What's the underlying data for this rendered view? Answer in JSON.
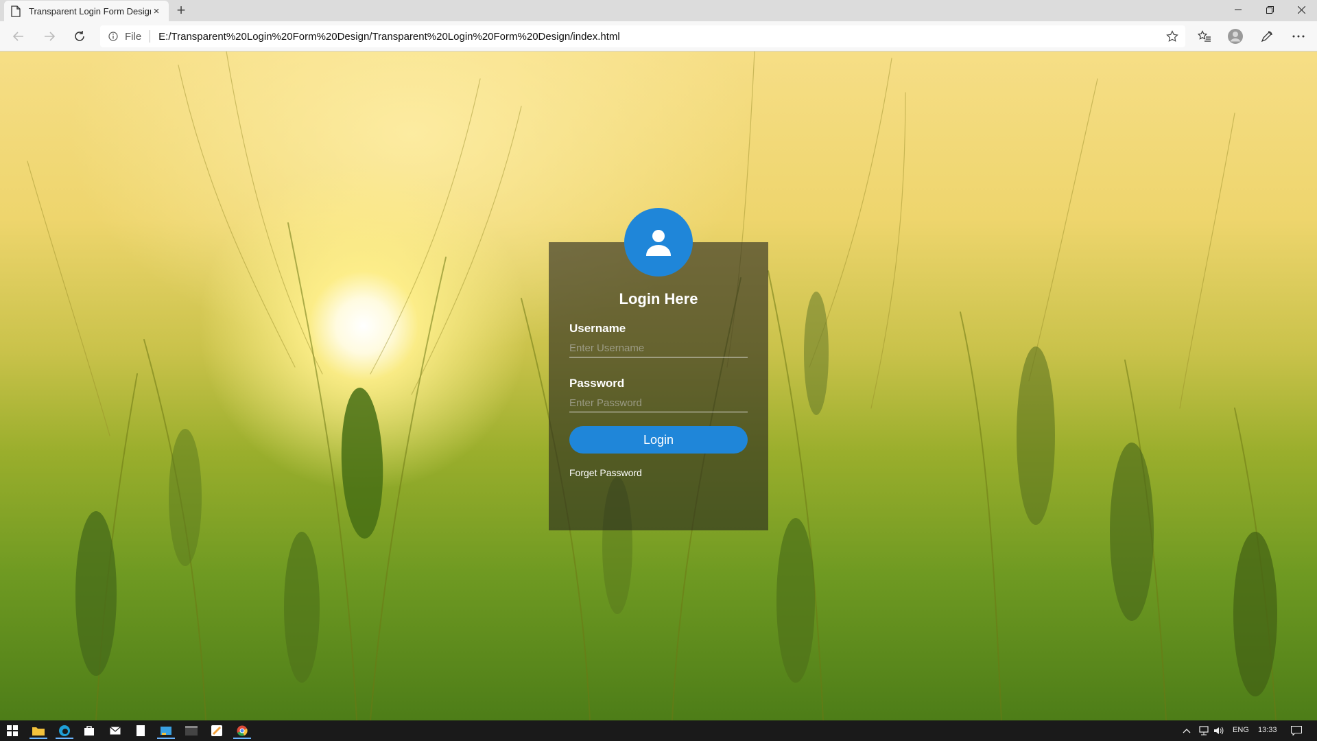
{
  "browser": {
    "tab_title": "Transparent Login Form Design",
    "tab_close": "×",
    "new_tab": "+",
    "address_prefix": "File",
    "url": "E:/Transparent%20Login%20Form%20Design/Transparent%20Login%20Form%20Design/index.html"
  },
  "login": {
    "title": "Login Here",
    "username_label": "Username",
    "username_placeholder": "Enter Username",
    "password_label": "Password",
    "password_placeholder": "Enter Password",
    "button_label": "Login",
    "forget_link": "Forget Password"
  },
  "taskbar": {
    "language": "ENG",
    "time": "13:33"
  },
  "colors": {
    "accent": "#1f86d9",
    "card": "rgba(40,40,30,0.62)"
  },
  "icons": [
    "page-icon",
    "back-icon",
    "forward-icon",
    "refresh-icon",
    "info-icon",
    "star-icon",
    "favorites-icon",
    "profile-icon",
    "read-aloud-icon",
    "more-icon",
    "user-icon"
  ]
}
